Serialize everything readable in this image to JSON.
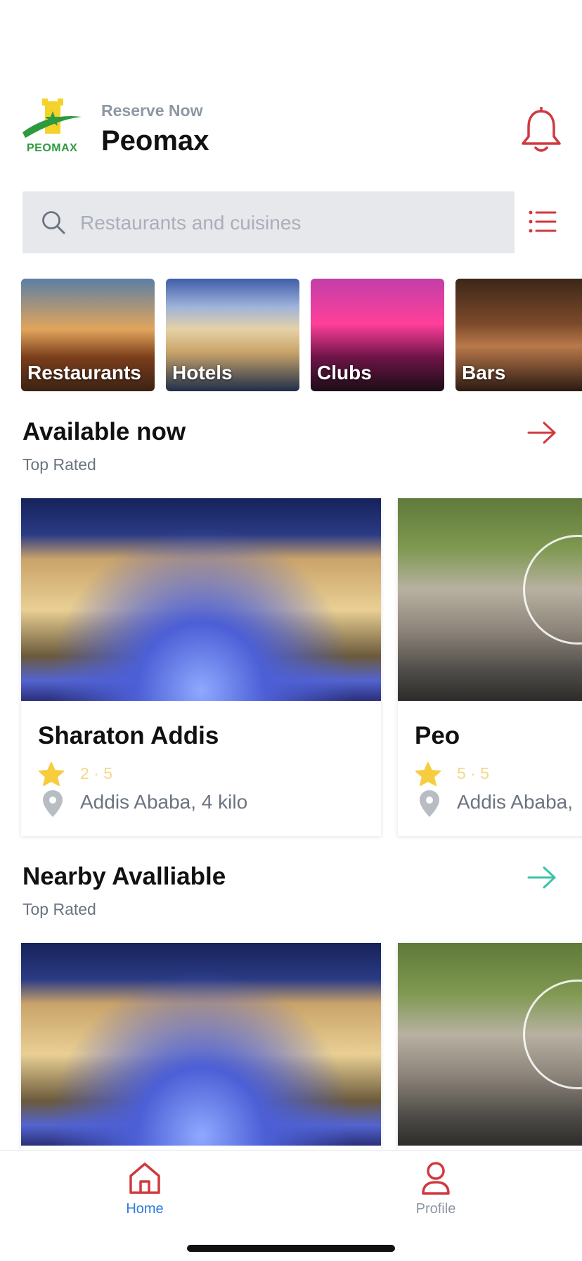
{
  "header": {
    "subtitle": "Reserve Now",
    "title": "Peomax",
    "logo_text": "PEOMAX"
  },
  "search": {
    "placeholder": "Restaurants and cuisines"
  },
  "categories": [
    {
      "label": "Restaurants"
    },
    {
      "label": "Hotels"
    },
    {
      "label": "Clubs"
    },
    {
      "label": "Bars"
    }
  ],
  "available": {
    "title": "Available now",
    "subtitle": "Top Rated",
    "cards": [
      {
        "name": "Sharaton Addis",
        "rating": "2 · 5",
        "location": "Addis Ababa, 4 kilo"
      },
      {
        "name": "Peo",
        "rating": "5 · 5",
        "location": "Addis Ababa,"
      }
    ]
  },
  "nearby": {
    "title": "Nearby Avalliable",
    "subtitle": "Top Rated"
  },
  "nav": {
    "home": "Home",
    "profile": "Profile"
  },
  "colors": {
    "accent_red": "#d0393f",
    "teal": "#3cc4a6",
    "active_blue": "#2d7be0",
    "star": "#f7cc3f"
  }
}
